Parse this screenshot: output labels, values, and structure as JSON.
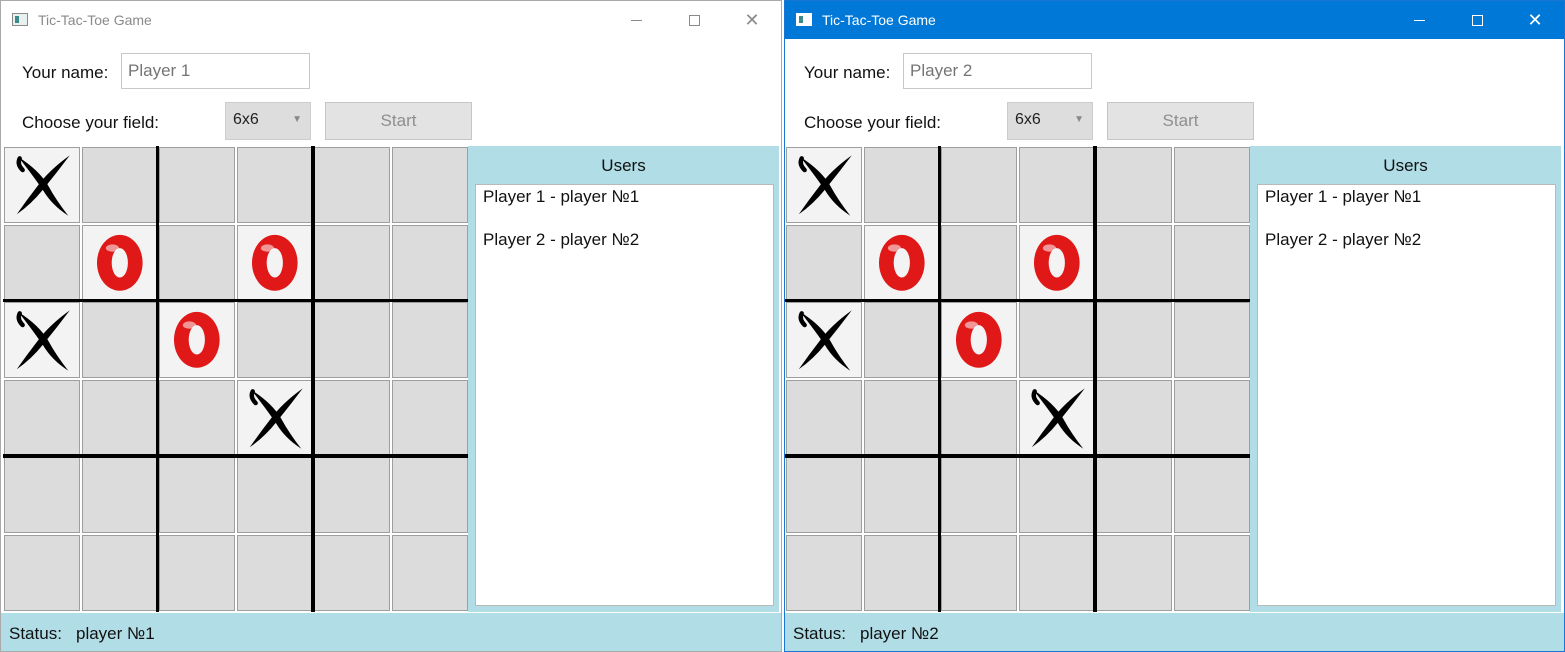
{
  "windows": [
    {
      "title": "Tic-Tac-Toe Game",
      "active": false,
      "name_label": "Your name:",
      "name_placeholder": "Player 1",
      "field_label": "Choose your field:",
      "field_value": "6x6",
      "start_label": "Start",
      "users_title": "Users",
      "users": [
        "Player 1 - player №1",
        "Player 2 - player №2"
      ],
      "status_label": "Status:",
      "status_value": "player №1"
    },
    {
      "title": "Tic-Tac-Toe Game",
      "active": true,
      "name_label": "Your name:",
      "name_placeholder": "Player 2",
      "field_label": "Choose your field:",
      "field_value": "6x6",
      "start_label": "Start",
      "users_title": "Users",
      "users": [
        "Player 1 - player №1",
        "Player 2 - player №2"
      ],
      "status_label": "Status:",
      "status_value": "player №2"
    }
  ],
  "board": [
    [
      "X",
      "",
      "",
      "",
      "",
      ""
    ],
    [
      "",
      "O",
      "",
      "O",
      "",
      ""
    ],
    [
      "X",
      "",
      "O",
      "",
      "",
      ""
    ],
    [
      "",
      "",
      "",
      "X",
      "",
      ""
    ],
    [
      "",
      "",
      "",
      "",
      "",
      ""
    ],
    [
      "",
      "",
      "",
      "",
      "",
      ""
    ]
  ],
  "colors": {
    "active_titlebar": "#0078d7",
    "panel": "#b0dde6",
    "cell": "#dcdcdc",
    "o_mark": "#e01818",
    "x_mark": "#000000"
  },
  "icons": {
    "app": "app-window-icon",
    "minimize": "minimize-icon",
    "maximize": "maximize-icon",
    "close": "close-icon",
    "dropdown": "chevron-down-icon"
  }
}
